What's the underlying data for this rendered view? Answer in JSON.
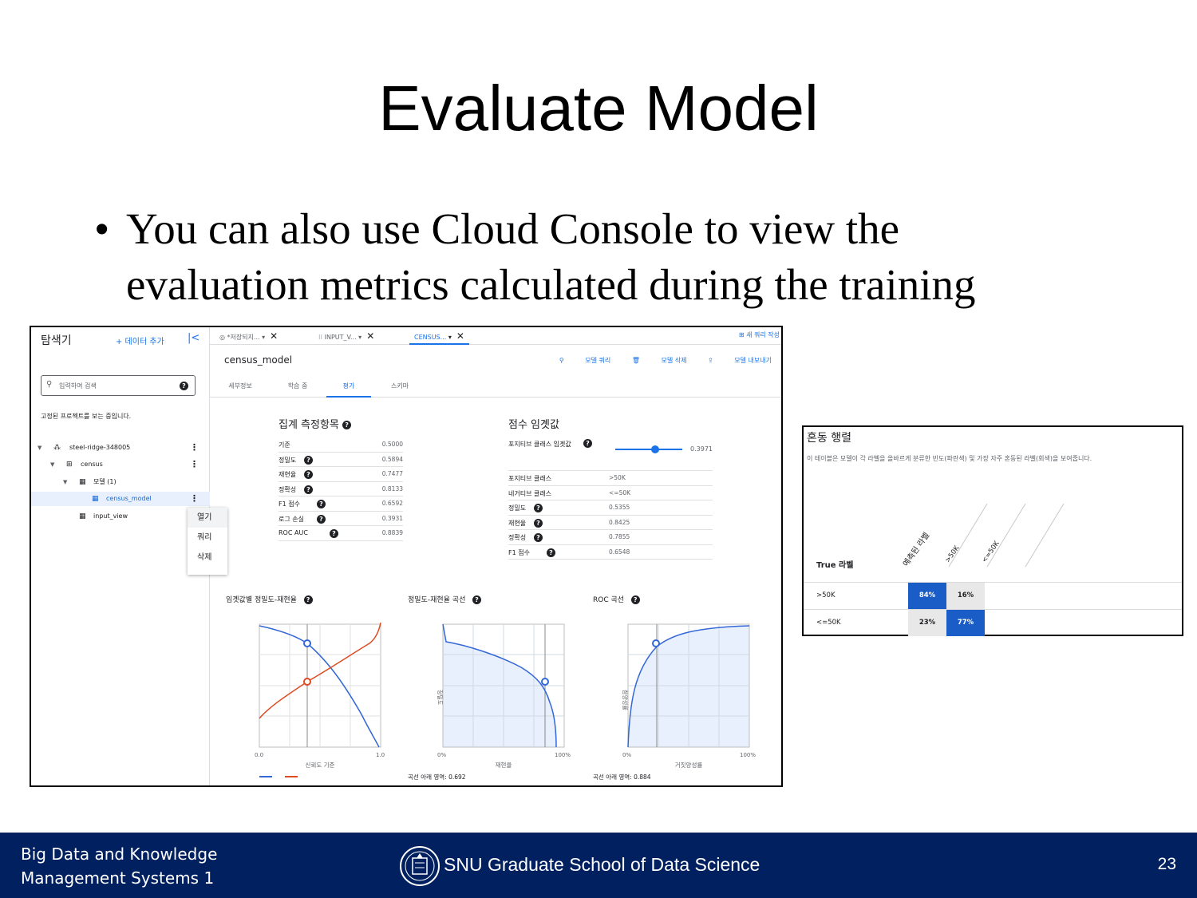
{
  "slide": {
    "title": "Evaluate Model",
    "bullet_dot": "•",
    "bullet_text": "You can also use Cloud Console to view the evaluation metrics calculated during the training"
  },
  "explorer": {
    "title": "탐색기",
    "add_data": "+ 데이터 추가",
    "collapse_icon": "|<",
    "search_placeholder": "입력하여 검색",
    "pinned_note": "고정된 프로젝트를 보는 중입니다.",
    "tree": [
      {
        "label": "steel-ridge-348005",
        "icon": "project-icon"
      },
      {
        "label": "census",
        "icon": "dataset-icon"
      },
      {
        "label": "모델 (1)",
        "icon": "folder-icon"
      },
      {
        "label": "census_model",
        "icon": "model-icon"
      },
      {
        "label": "input_view",
        "icon": "view-icon"
      }
    ],
    "context_menu": [
      "열기",
      "쿼리",
      "삭제"
    ]
  },
  "tabs": [
    {
      "label": "*저장되지..."
    },
    {
      "label": "INPUT_V..."
    },
    {
      "label": "CENSUS..."
    }
  ],
  "new_query": "새 쿼리 작성",
  "model": {
    "name": "census_model",
    "actions": [
      "모델 쿼리",
      "모델 삭제",
      "모델 내보내기"
    ],
    "subtabs": [
      "세부정보",
      "학습 중",
      "평가",
      "스키마"
    ]
  },
  "aggregate": {
    "title": "집계 측정항목",
    "rows": [
      {
        "k": "기준",
        "v": "0.5000"
      },
      {
        "k": "정밀도",
        "v": "0.5894"
      },
      {
        "k": "재현율",
        "v": "0.7477"
      },
      {
        "k": "정확성",
        "v": "0.8133"
      },
      {
        "k": "F1 점수",
        "v": "0.6592"
      },
      {
        "k": "로그 손실",
        "v": "0.3931"
      },
      {
        "k": "ROC AUC",
        "v": "0.8839"
      }
    ]
  },
  "threshold": {
    "title": "점수 임곗값",
    "slider_label": "포지티브 클래스 임곗값",
    "slider_value": 0.3971,
    "slider_value_text": "0.3971",
    "rows": [
      {
        "k": "포지티브 클래스",
        "v": ">50K"
      },
      {
        "k": "네거티브 클래스",
        "v": "<=50K"
      },
      {
        "k": "정밀도",
        "v": "0.5355"
      },
      {
        "k": "재현율",
        "v": "0.8425"
      },
      {
        "k": "정확성",
        "v": "0.7855"
      },
      {
        "k": "F1 점수",
        "v": "0.6548"
      }
    ]
  },
  "charts": {
    "pr_threshold": {
      "title": "임곗값별 정밀도-재현율",
      "xlabel": "신뢰도 기준",
      "x_ticks": [
        "0.0",
        "1.0"
      ]
    },
    "pr_curve": {
      "title": "정밀도-재현율 곡선",
      "xlabel": "재현율",
      "ylabel": "정밀도",
      "x_ticks": [
        "0%",
        "100%"
      ],
      "auc_text": "곡선 아래 영역: 0.692"
    },
    "roc": {
      "title": "ROC 곡선",
      "xlabel": "거짓양성률",
      "ylabel": "참양성률",
      "x_ticks": [
        "0%",
        "100%"
      ],
      "auc_text": "곡선 아래 영역: 0.884"
    },
    "series_colors": {
      "precision": "#3367d6",
      "recall": "#dd4b22"
    }
  },
  "confusion": {
    "title": "혼동 행렬",
    "desc": "이 테이블은 모델이 각 라벨을 올바르게 분류한 빈도(파란색) 및 가장 자주 혼동된 라벨(회색)을 보여줍니다.",
    "true_label": "True 라벨",
    "pred_label": "예측된 라벨",
    "cols": [
      ">50K",
      "<=50K"
    ],
    "rows": [
      {
        "label": ">50K",
        "cells": [
          "84%",
          "16%"
        ]
      },
      {
        "label": "<=50K",
        "cells": [
          "23%",
          "77%"
        ]
      }
    ],
    "blue": "#1a5dc7",
    "gray": "#e8e8e8"
  },
  "footer": {
    "course_line1": "Big Data and Knowledge",
    "course_line2": "Management Systems 1",
    "school": "SNU Graduate School of Data Science",
    "page": "23",
    "background": "#002060"
  }
}
